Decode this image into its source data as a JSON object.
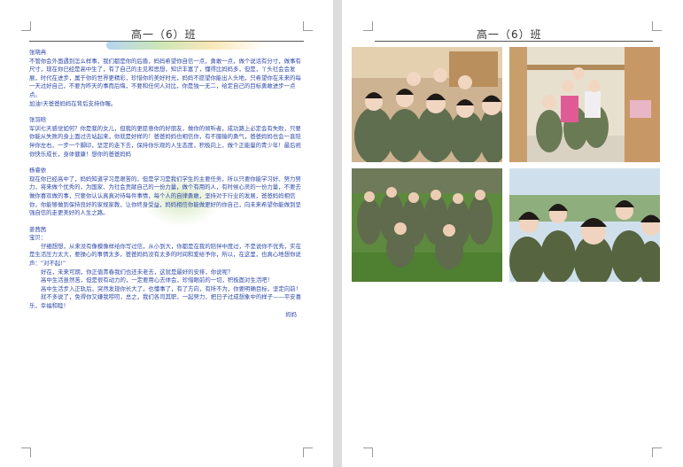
{
  "header": {
    "title": "高一（6）班"
  },
  "letters": [
    {
      "name": "张晓冉",
      "paragraphs": [
        "不管你会外面遇到怎么样事，我们都是你的后盾，妈妈希望你自信一点，勇敢一点，做个说话有分寸，做事有尺寸，现在你已经是高中生了，有了自己的主见和思想，知识丰富了，懂得比妈妈多，但是，丫头社会会发展，时代在进步，属于你的世界更精彩，珍惜你的美好时光，妈妈不愿望你能出人头地，只希望你在未来的每一天过好自己，不要为昨天的事而后悔，不要和任何人对比，你是独一无二，给定自己的目标勇敢进步一点点。",
        "加油!天爸爸妈妈在背后支持你喔。"
      ]
    },
    {
      "name": "张羽晗",
      "paragraphs": [
        "军训七天感觉如何？你是我的女儿，但我的更愿意你的好朋友，做你的倾听者，成功路上必定会有失败，只要你能从失败的身上面过去站起来，你就是好样的！爸爸妈妈也相信你，有不服输的勇气，爸爸妈妈也会一直陪伴你左右，一步一个脚印，坚定的走下去，保持你乐观的人生态度，积极向上，做个正能量的青少年！最后祝你快乐成长，身体健康！想你的爸爸妈妈"
      ]
    },
    {
      "name": "杨睿依",
      "paragraphs": [
        "现在你已经高中了，妈妈知道学习是艰苦的，但是学习是我们学生的主要任务，所以只要你能学习好、努力努力，将来做个优秀的，为国家、为社会贡献自己的一份力量，做个有用的人，有时候心灵的一份力量，不要去做你喜欢做的事，只要你认认真真对待每件事情，每个人的自律勇敢，坚持对于行业的发展，爸爸妈妈相信你，你能够做到保持良好的家规家教，让你终身受益，妈妈相信你能做更好的你自己，向未来希望你能做到坚强自信的走更美好的人生之路。"
      ]
    },
    {
      "name": "姜茜茜",
      "salutation": "宝贝：",
      "paragraphs": [
        "仔细想想，从来没有像模像样给你写过信，从小到大，你都是在我的陪伴中度过，不是说你不优秀，实在是生活压力太大，要操心的事情太多，爸爸妈妈没有太多的时间和爱给予你，所以，在这里，也真心地想你说声：“对不起!”",
        "好在，未来可期，你正值青春我们也还未老去，这就是最好的安排，你说呢？",
        "高中生活虽然苦，但是很有动力的，一定要用心去体会，珍惜眼前的一切，积极面对生活吧！",
        "高中生活步入正轨后，突然发现你长大了，也懂事了，有了方向，有所不为，你要明确目标，坚定向前！",
        "就不多说了，免得你又嫌我唠叨，总之，我们各司其职，一起努力，把日子过成想象中的样子——平安喜乐，幸福和睦！"
      ],
      "signature": "妈妈"
    }
  ],
  "photos": [
    {
      "alt": "宿舍里的女生合影",
      "colors": {
        "bg": "#cdb391",
        "fg": "#5e6e4e"
      }
    },
    {
      "alt": "宿舍里穿迷彩服的女生",
      "colors": {
        "bg": "#e8e0cf",
        "fg": "#6a7a55"
      }
    },
    {
      "alt": "草坪上的军训合影",
      "colors": {
        "bg": "#5d8a3e",
        "fg": "#5f6b4c"
      }
    },
    {
      "alt": "户外女生自拍",
      "colors": {
        "bg": "#cfe0ec",
        "fg": "#56643f"
      }
    }
  ],
  "colors": {
    "body_text": "#2f49a8",
    "page": "#ffffff",
    "background": "#e9e9e9"
  }
}
